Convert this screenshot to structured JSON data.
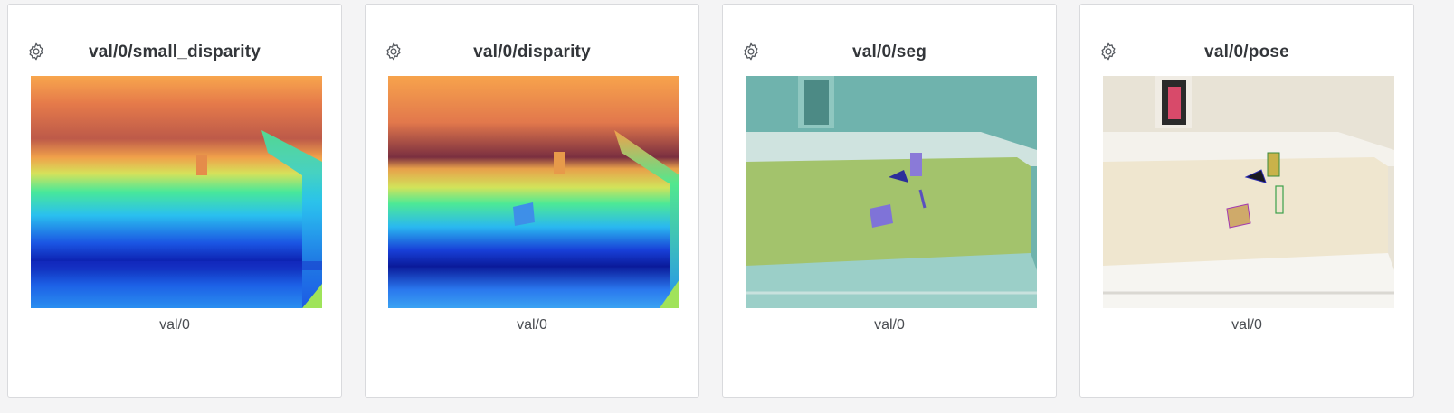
{
  "panels": [
    {
      "title": "val/0/small_disparity",
      "caption": "val/0",
      "settings_icon": "gear-icon"
    },
    {
      "title": "val/0/disparity",
      "caption": "val/0",
      "settings_icon": "gear-icon"
    },
    {
      "title": "val/0/seg",
      "caption": "val/0",
      "settings_icon": "gear-icon"
    },
    {
      "title": "val/0/pose",
      "caption": "val/0",
      "settings_icon": "gear-icon"
    }
  ],
  "colors": {
    "background": "#f4f4f5",
    "panel_border": "#d9dadd",
    "title_text": "#33363a"
  }
}
